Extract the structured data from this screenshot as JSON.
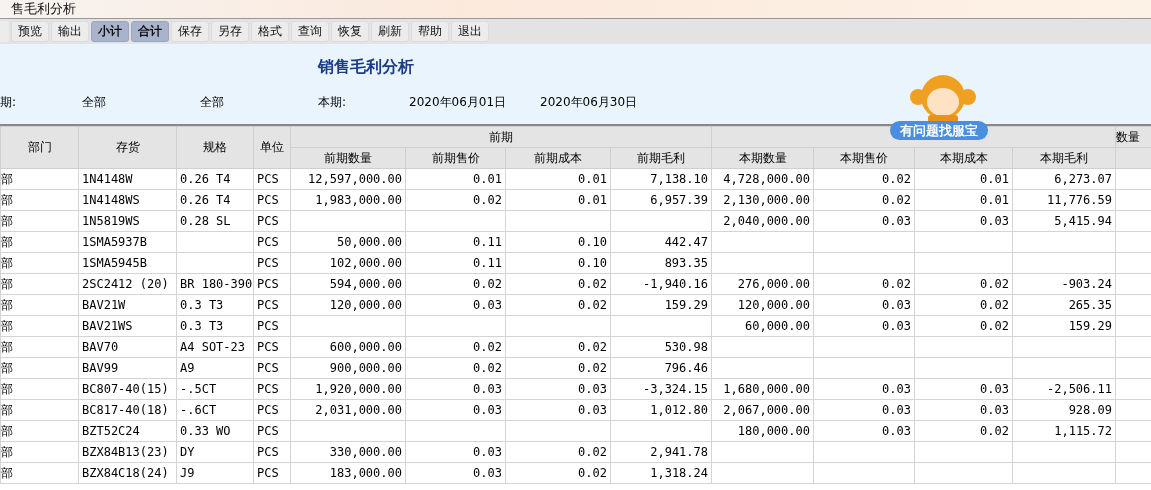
{
  "window": {
    "title": "售毛利分析"
  },
  "toolbar": [
    {
      "label": "预览",
      "selected": false
    },
    {
      "label": "输出",
      "selected": false
    },
    {
      "label": "小计",
      "selected": true
    },
    {
      "label": "合计",
      "selected": true
    },
    {
      "label": "保存",
      "selected": false
    },
    {
      "label": "另存",
      "selected": false
    },
    {
      "label": "格式",
      "selected": false
    },
    {
      "label": "查询",
      "selected": false
    },
    {
      "label": "恢复",
      "selected": false
    },
    {
      "label": "刷新",
      "selected": false
    },
    {
      "label": "帮助",
      "selected": false
    },
    {
      "label": "退出",
      "selected": false
    }
  ],
  "report": {
    "title": "销售毛利分析",
    "prev_label": "期:",
    "prev_from": "全部",
    "prev_to": "全部",
    "cur_label": "本期:",
    "cur_from": "2020年06月01日",
    "cur_to": "2020年06月30日"
  },
  "help_badge": {
    "label": "有问题找服宝"
  },
  "table": {
    "columns": [
      "部门",
      "存货",
      "规格",
      "单位"
    ],
    "group_prev": "前期",
    "sub_columns": [
      "前期数量",
      "前期售价",
      "前期成本",
      "前期毛利",
      "本期数量",
      "本期售价",
      "本期成本",
      "本期毛利"
    ],
    "column_13": "数量",
    "rows": [
      [
        "部",
        "1N4148W",
        "0.26 T4",
        "PCS",
        "12,597,000.00",
        "0.01",
        "0.01",
        "7,138.10",
        "4,728,000.00",
        "0.02",
        "0.01",
        "6,273.07"
      ],
      [
        "部",
        "1N4148WS",
        "0.26 T4",
        "PCS",
        "1,983,000.00",
        "0.02",
        "0.01",
        "6,957.39",
        "2,130,000.00",
        "0.02",
        "0.01",
        "11,776.59"
      ],
      [
        "部",
        "1N5819WS",
        "0.28 SL",
        "PCS",
        null,
        null,
        null,
        null,
        "2,040,000.00",
        "0.03",
        "0.03",
        "5,415.94"
      ],
      [
        "部",
        "1SMA5937B",
        null,
        "PCS",
        "50,000.00",
        "0.11",
        "0.10",
        "442.47",
        null,
        null,
        null,
        null
      ],
      [
        "部",
        "1SMA5945B",
        null,
        "PCS",
        "102,000.00",
        "0.11",
        "0.10",
        "893.35",
        null,
        null,
        null,
        null
      ],
      [
        "部",
        "2SC2412 (20)",
        "BR 180-390",
        "PCS",
        "594,000.00",
        "0.02",
        "0.02",
        "-1,940.16",
        "276,000.00",
        "0.02",
        "0.02",
        "-903.24"
      ],
      [
        "部",
        "BAV21W",
        "0.3 T3",
        "PCS",
        "120,000.00",
        "0.03",
        "0.02",
        "159.29",
        "120,000.00",
        "0.03",
        "0.02",
        "265.35"
      ],
      [
        "部",
        "BAV21WS",
        "0.3 T3",
        "PCS",
        null,
        null,
        null,
        null,
        "60,000.00",
        "0.03",
        "0.02",
        "159.29"
      ],
      [
        "部",
        "BAV70",
        "A4 SOT-23",
        "PCS",
        "600,000.00",
        "0.02",
        "0.02",
        "530.98",
        null,
        null,
        null,
        null
      ],
      [
        "部",
        "BAV99",
        "A9",
        "PCS",
        "900,000.00",
        "0.02",
        "0.02",
        "796.46",
        null,
        null,
        null,
        null
      ],
      [
        "部",
        "BC807-40(15)",
        "-.5CT",
        "PCS",
        "1,920,000.00",
        "0.03",
        "0.03",
        "-3,324.15",
        "1,680,000.00",
        "0.03",
        "0.03",
        "-2,506.11"
      ],
      [
        "部",
        "BC817-40(18)",
        "-.6CT",
        "PCS",
        "2,031,000.00",
        "0.03",
        "0.03",
        "1,012.80",
        "2,067,000.00",
        "0.03",
        "0.03",
        "928.09"
      ],
      [
        "部",
        "BZT52C24",
        "0.33 WO",
        "PCS",
        null,
        null,
        null,
        null,
        "180,000.00",
        "0.03",
        "0.02",
        "1,115.72"
      ],
      [
        "部",
        "BZX84B13(23)",
        "DY",
        "PCS",
        "330,000.00",
        "0.03",
        "0.02",
        "2,941.78",
        null,
        null,
        null,
        null
      ],
      [
        "部",
        "BZX84C18(24)",
        "J9",
        "PCS",
        "183,000.00",
        "0.03",
        "0.02",
        "1,318.24",
        null,
        null,
        null,
        null
      ]
    ]
  }
}
